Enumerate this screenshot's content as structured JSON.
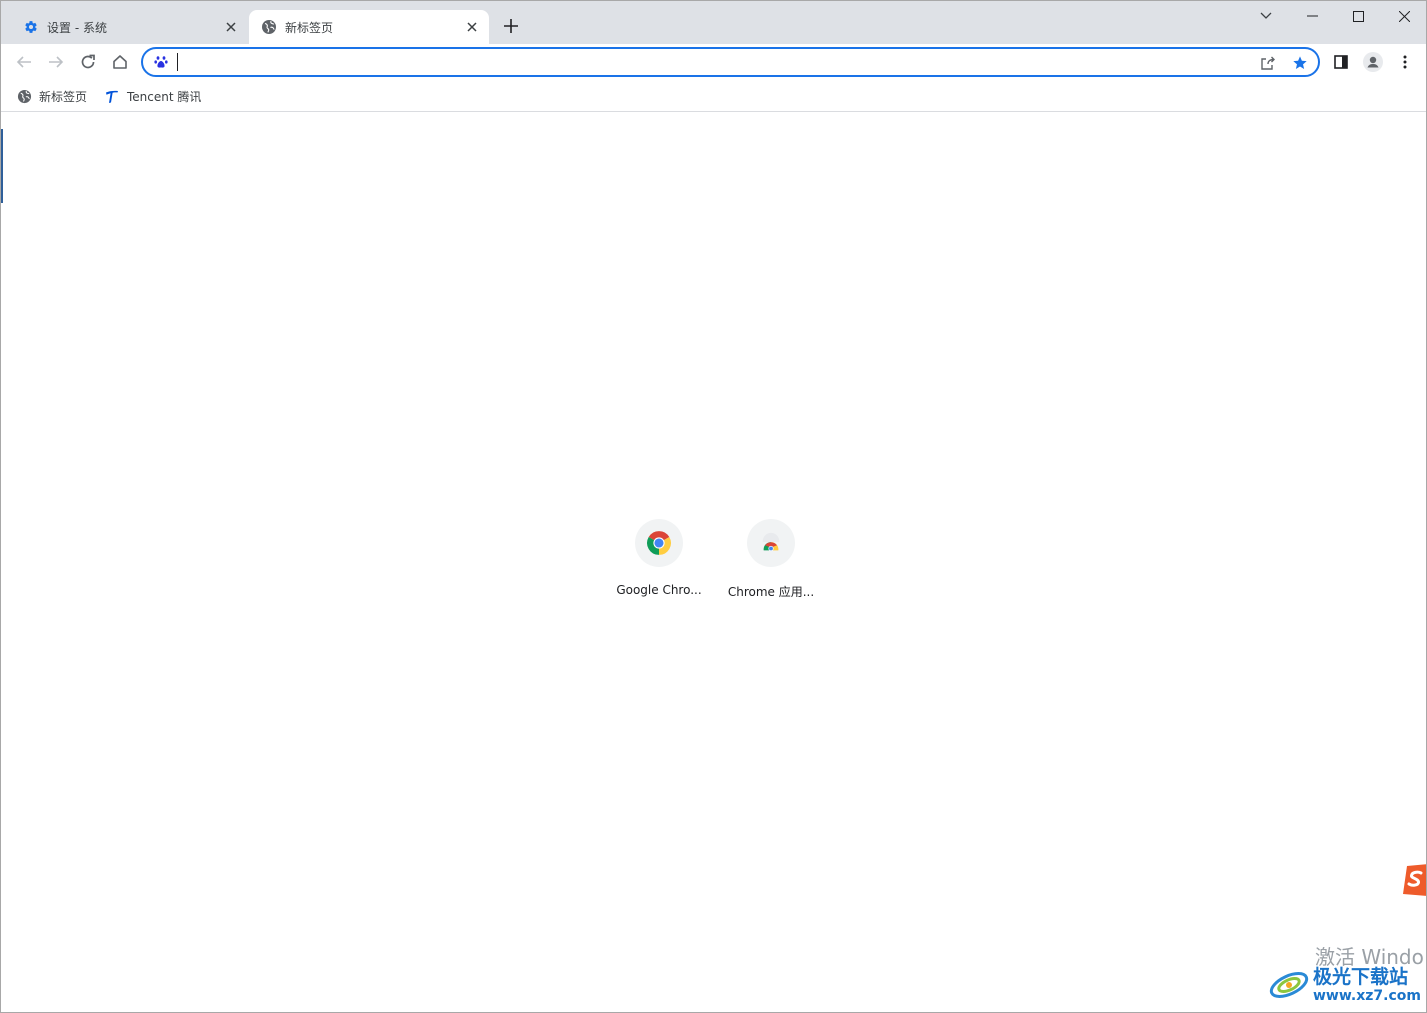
{
  "tabs": [
    {
      "title": "设置 - 系统",
      "icon": "gear-icon",
      "active": false
    },
    {
      "title": "新标签页",
      "icon": "globe-icon",
      "active": true
    }
  ],
  "new_tab_label": "+",
  "omnibox": {
    "value": "",
    "engine_icon": "baidu-paw-icon"
  },
  "bookmarks": [
    {
      "label": "新标签页",
      "icon": "globe-icon"
    },
    {
      "label": "Tencent 腾讯",
      "icon": "tencent-icon"
    }
  ],
  "shortcuts": [
    {
      "label": "Google Chro...",
      "icon": "chrome-logo-icon"
    },
    {
      "label": "Chrome 应用...",
      "icon": "chrome-webstore-icon"
    }
  ],
  "watermark": {
    "activate_text": "激活 Windo",
    "site_name": "极光下载站",
    "site_url": "www.xz7.com"
  },
  "colors": {
    "accent": "#1a73e8",
    "tabstrip": "#dee1e6"
  }
}
